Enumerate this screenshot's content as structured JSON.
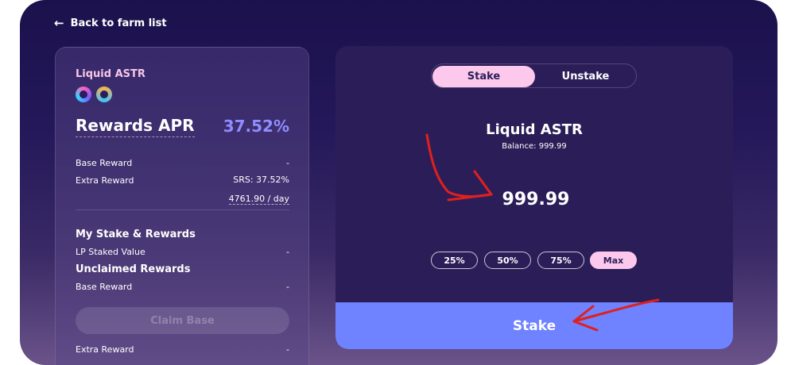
{
  "nav": {
    "back_label": "Back to farm list"
  },
  "farm": {
    "pair_name": "Liquid ASTR",
    "token_icons": [
      "astr-token-icon",
      "nastr-token-icon"
    ],
    "apr_label": "Rewards APR",
    "apr_value": "37.52%",
    "base_reward_label": "Base Reward",
    "base_reward_value": "-",
    "extra_reward_label": "Extra Reward",
    "extra_reward_value": "SRS:  37.52%",
    "extra_reward_per_day": "4761.90 / day"
  },
  "my_stake": {
    "title": "My Stake & Rewards",
    "lp_staked_label": "LP Staked Value",
    "lp_staked_value": "-",
    "unclaimed_title": "Unclaimed Rewards",
    "base_reward_label": "Base Reward",
    "base_reward_value": "-",
    "claim_base_label": "Claim Base",
    "extra_reward_label": "Extra Reward",
    "extra_reward_value": "-"
  },
  "stake_panel": {
    "tabs": [
      {
        "label": "Stake",
        "active": true
      },
      {
        "label": "Unstake",
        "active": false
      }
    ],
    "token_name": "Liquid ASTR",
    "balance": "Balance: 999.99",
    "amount": "999.99",
    "percent_buttons": [
      "25%",
      "50%",
      "75%",
      "Max"
    ],
    "submit_label": "Stake"
  },
  "colors": {
    "accent_pink": "#fcc9ec",
    "apr_purple": "#8f8dff",
    "stake_button": "#6f82ff",
    "annotation_red": "#e0201c"
  }
}
